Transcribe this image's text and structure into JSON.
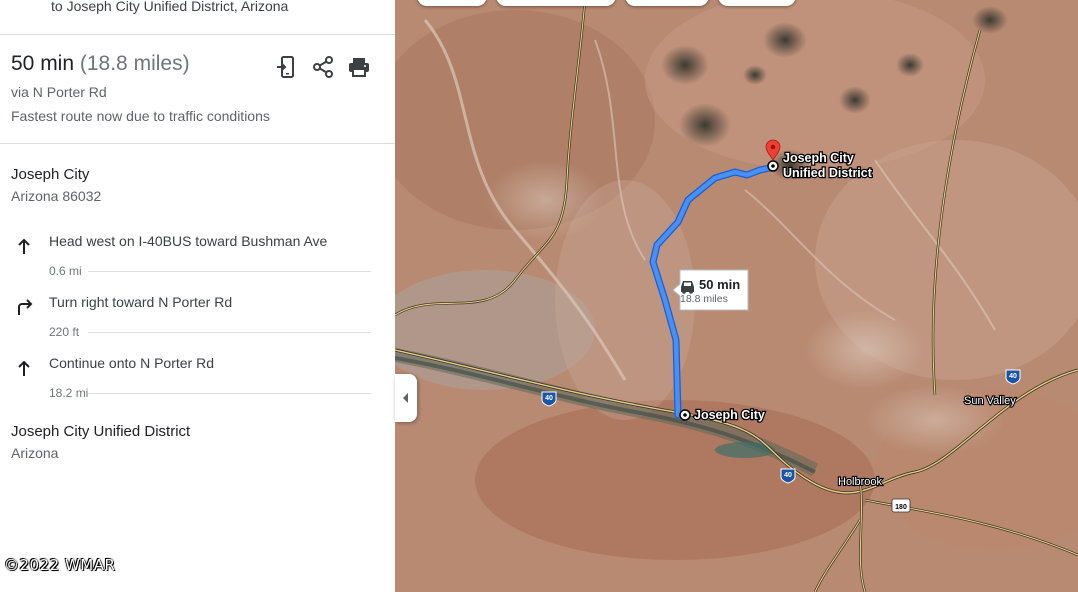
{
  "header": {
    "destination_line": "to Joseph City Unified District, Arizona"
  },
  "summary": {
    "duration": "50 min",
    "distance": "(18.8 miles)",
    "via": "via N Porter Rd",
    "note": "Fastest route now due to traffic conditions",
    "actions": [
      {
        "icon": "send-to-phone-icon"
      },
      {
        "icon": "share-icon"
      },
      {
        "icon": "print-icon"
      }
    ]
  },
  "origin": {
    "name": "Joseph City",
    "subtitle": "Arizona 86032"
  },
  "steps": [
    {
      "icon": "arrow-up-icon",
      "instruction": "Head west on I-40BUS toward Bushman Ave",
      "distance": "0.6 mi"
    },
    {
      "icon": "turn-right-icon",
      "instruction": "Turn right toward N Porter Rd",
      "distance": "220 ft"
    },
    {
      "icon": "arrow-up-icon",
      "instruction": "Continue onto N Porter Rd",
      "distance": "18.2 mi"
    }
  ],
  "destination": {
    "name": "Joseph City Unified District",
    "subtitle": "Arizona"
  },
  "copyright": "©2022 WMAR",
  "map": {
    "route_label": {
      "duration": "50 min",
      "distance": "18.8 miles"
    },
    "destination_label_line1": "Joseph City",
    "destination_label_line2": "Unified District",
    "origin_label": "Joseph City",
    "places": [
      "Sun Valley",
      "Holbrook"
    ],
    "shields": [
      "40",
      "40",
      "40",
      "40",
      "180"
    ],
    "colors": {
      "route": "#4285f4",
      "route_border": "#1a5fd0",
      "pin": "#ea4335",
      "terrain": "#b98a72"
    }
  }
}
